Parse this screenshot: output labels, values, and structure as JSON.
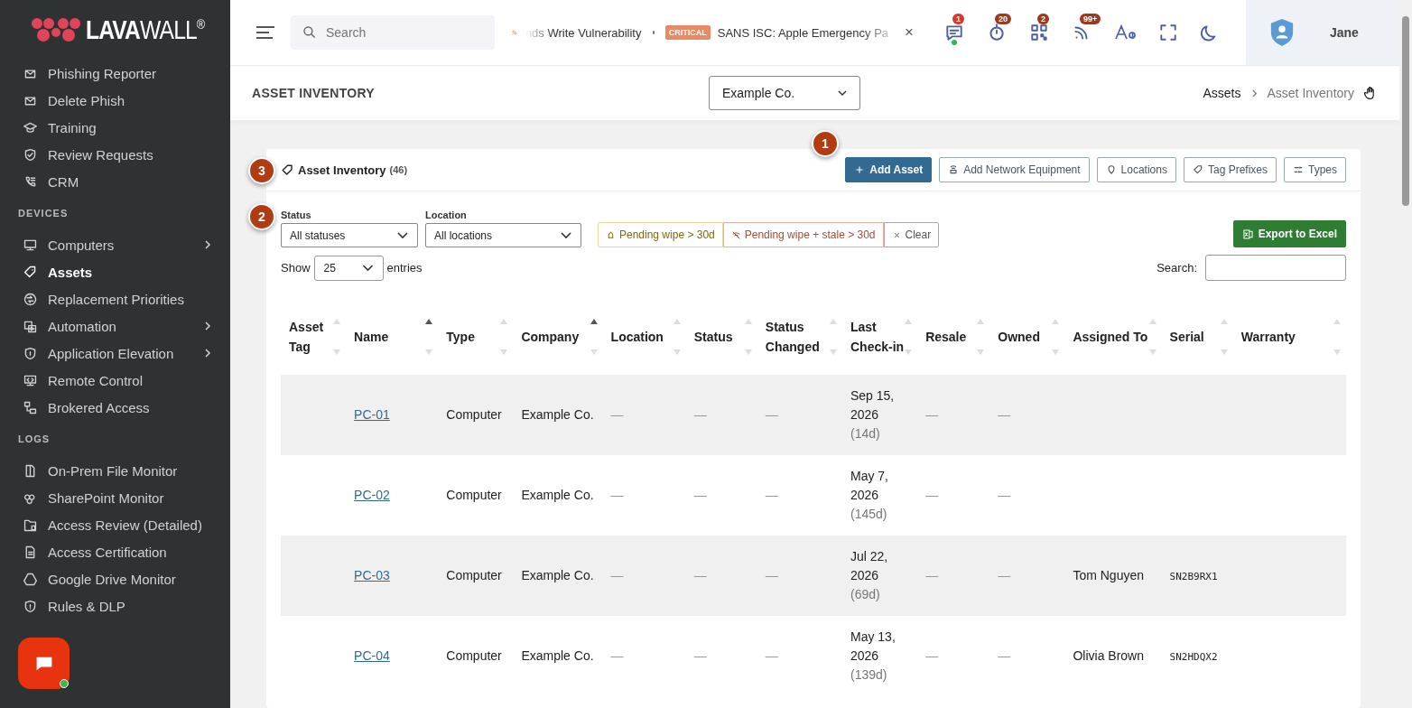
{
  "logo": {
    "text_bold": "LAVA",
    "text_light": "WALL",
    "mark": "®"
  },
  "sidebar": {
    "sections": [
      {
        "items": [
          {
            "label": "Phishing Reporter",
            "selected": false,
            "has_submenu": false
          },
          {
            "label": "Delete Phish",
            "selected": false,
            "has_submenu": false
          },
          {
            "label": "Training",
            "selected": false,
            "has_submenu": false
          },
          {
            "label": "Review Requests",
            "selected": false,
            "has_submenu": false
          },
          {
            "label": "CRM",
            "selected": false,
            "has_submenu": false
          }
        ]
      },
      {
        "heading": "DEVICES",
        "items": [
          {
            "label": "Computers",
            "selected": false,
            "has_submenu": true
          },
          {
            "label": "Assets",
            "selected": true,
            "has_submenu": false
          },
          {
            "label": "Replacement Priorities",
            "selected": false,
            "has_submenu": false
          },
          {
            "label": "Automation",
            "selected": false,
            "has_submenu": true
          },
          {
            "label": "Application Elevation",
            "selected": false,
            "has_submenu": true
          },
          {
            "label": "Remote Control",
            "selected": false,
            "has_submenu": false
          },
          {
            "label": "Brokered Access",
            "selected": false,
            "has_submenu": false
          }
        ]
      },
      {
        "heading": "LOGS",
        "items": [
          {
            "label": "On-Prem File Monitor",
            "selected": false,
            "has_submenu": false
          },
          {
            "label": "SharePoint Monitor",
            "selected": false,
            "has_submenu": false
          },
          {
            "label": "Access Review (Detailed)",
            "selected": false,
            "has_submenu": false
          },
          {
            "label": "Access Certification",
            "selected": false,
            "has_submenu": false
          },
          {
            "label": "Google Drive Monitor",
            "selected": false,
            "has_submenu": false
          },
          {
            "label": "Rules & DLP",
            "selected": false,
            "has_submenu": false
          }
        ]
      }
    ]
  },
  "chat_button": {
    "online": true
  },
  "topbar": {
    "search": {
      "placeholder": "Search"
    },
    "ticker": [
      {
        "text": "nds Write Vulnerability"
      },
      {
        "badge": "CRITICAL",
        "text": "SANS ISC: Apple Emergency Pa"
      }
    ],
    "ticker_close": "×",
    "icons": [
      {
        "badge": "1",
        "color": "#d63a2f",
        "online": true
      },
      {
        "badge": "20",
        "color": "#9b3a1e",
        "online": false
      },
      {
        "badge": "2",
        "color": "#9b3a1e",
        "online": false
      },
      {
        "badge": "99+",
        "color": "#9b3a1e",
        "online": false
      }
    ],
    "user": "Jane"
  },
  "page_header": {
    "title": "ASSET INVENTORY",
    "company_select": "Example Co.",
    "breadcrumb": [
      "Assets",
      "Asset Inventory"
    ]
  },
  "card": {
    "title": "Asset Inventory",
    "count": "(46)",
    "callouts": [
      "1",
      "2",
      "3"
    ],
    "buttons": [
      {
        "label": "Add Asset",
        "kind": "primary"
      },
      {
        "label": "Add Network Equipment",
        "kind": "outline"
      },
      {
        "label": "Locations",
        "kind": "outline"
      },
      {
        "label": "Tag Prefixes",
        "kind": "outline"
      },
      {
        "label": "Types",
        "kind": "outline"
      }
    ],
    "filters": [
      {
        "label": "Status",
        "value": "All statuses"
      },
      {
        "label": "Location",
        "value": "All locations"
      }
    ],
    "quick_filters": [
      {
        "label": "Pending wipe > 30d",
        "kind": "warning"
      },
      {
        "label": "Pending wipe + stale > 30d",
        "kind": "danger"
      },
      {
        "label": "Clear",
        "kind": "clear"
      }
    ],
    "export_button": "Export to Excel",
    "show_label": "Show",
    "page_size": "25",
    "entries_label": "entries",
    "search_label": "Search:"
  },
  "table": {
    "columns": [
      {
        "label": "Asset Tag",
        "sorted": false
      },
      {
        "label": "Name",
        "sorted": true
      },
      {
        "label": "Type",
        "sorted": false
      },
      {
        "label": "Company",
        "sorted": true
      },
      {
        "label": "Location",
        "sorted": false
      },
      {
        "label": "Status",
        "sorted": false
      },
      {
        "label": "Status Changed",
        "sorted": false
      },
      {
        "label": "Last Check-in",
        "sorted": false
      },
      {
        "label": "Resale",
        "sorted": false
      },
      {
        "label": "Owned",
        "sorted": false
      },
      {
        "label": "Assigned To",
        "sorted": false
      },
      {
        "label": "Serial",
        "sorted": false
      },
      {
        "label": "Warranty",
        "sorted": false
      }
    ],
    "rows": [
      {
        "name": "PC-01",
        "type": "Computer",
        "company": "Example Co.",
        "location": "—",
        "status": "—",
        "status_changed": "—",
        "last_checkin": "Sep 15, 2026",
        "age": "(14d)",
        "resale": "—",
        "owned": "—"
      },
      {
        "name": "PC-02",
        "type": "Computer",
        "company": "Example Co.",
        "location": "—",
        "status": "—",
        "status_changed": "—",
        "last_checkin": "May 7, 2026",
        "age": "(145d)",
        "resale": "—",
        "owned": "—"
      },
      {
        "name": "PC-03",
        "type": "Computer",
        "company": "Example Co.",
        "location": "—",
        "status": "—",
        "status_changed": "—",
        "last_checkin": "Jul 22, 2026",
        "age": "(69d)",
        "resale": "—",
        "owned": "—",
        "assigned_to": "Tom Nguyen",
        "serial": "SN2B9RX1"
      },
      {
        "name": "PC-04",
        "type": "Computer",
        "company": "Example Co.",
        "location": "—",
        "status": "—",
        "status_changed": "—",
        "last_checkin": "May 13, 2026",
        "age": "(139d)",
        "resale": "—",
        "owned": "—",
        "assigned_to": "Olivia Brown",
        "serial": "SN2HDQX2"
      }
    ]
  }
}
